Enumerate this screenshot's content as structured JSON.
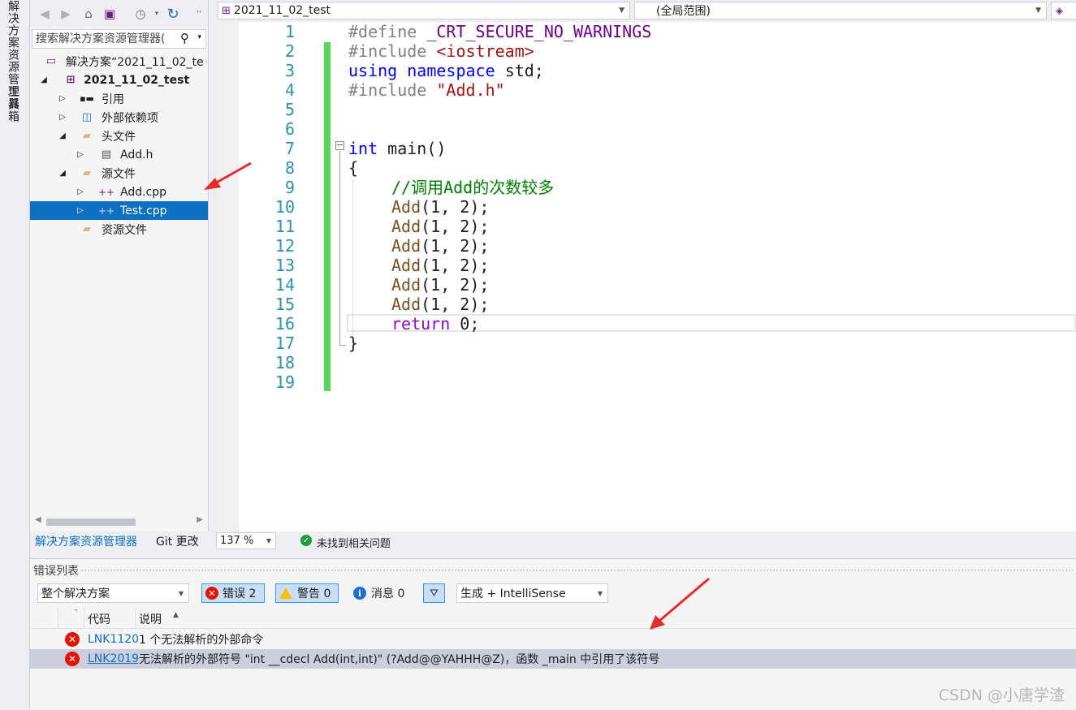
{
  "side_tabs": [
    "解决方案资源管理器",
    "工具箱"
  ],
  "solution_explorer": {
    "search_placeholder": "搜索解决方案资源管理器(",
    "tree": [
      {
        "label": "解决方案“2021_11_02_te",
        "icon": "solution-icon",
        "expander": ""
      },
      {
        "label": "2021_11_02_test",
        "icon": "project-icon",
        "expander": "expanded",
        "bold": true
      },
      {
        "label": "引用",
        "icon": "references-icon",
        "expander": "collapsed"
      },
      {
        "label": "外部依赖项",
        "icon": "external-deps-icon",
        "expander": "collapsed"
      },
      {
        "label": "头文件",
        "icon": "folder-icon",
        "expander": "expanded"
      },
      {
        "label": "Add.h",
        "icon": "header-file-icon",
        "expander": "collapsed"
      },
      {
        "label": "源文件",
        "icon": "folder-icon",
        "expander": "expanded"
      },
      {
        "label": "Add.cpp",
        "icon": "cpp-file-icon",
        "expander": "collapsed"
      },
      {
        "label": "Test.cpp",
        "icon": "cpp-file-icon",
        "expander": "collapsed",
        "selected": true
      },
      {
        "label": "资源文件",
        "icon": "folder-icon",
        "expander": ""
      }
    ],
    "bottom_tabs": [
      "解决方案资源管理器",
      "Git 更改"
    ]
  },
  "editor": {
    "project_dropdown": "2021_11_02_test",
    "scope_dropdown": "(全局范围)",
    "zoom": "137 %",
    "status": "未找到相关问题",
    "line_numbers": [
      "1",
      "2",
      "3",
      "4",
      "5",
      "6",
      "7",
      "8",
      "9",
      "10",
      "11",
      "12",
      "13",
      "14",
      "15",
      "16",
      "17",
      "18",
      "19"
    ],
    "lines": {
      "l1_directive": "#define",
      "l1_macro": "_CRT_SECURE_NO_WARNINGS",
      "l2_directive": "#include",
      "l2_header": "<iostream>",
      "l3_using": "using",
      "l3_namespace": "namespace",
      "l3_std": "std;",
      "l4_directive": "#include",
      "l4_header": "\"Add.h\"",
      "l7_int": "int",
      "l7_main": "main()",
      "l8": "{",
      "l9_comment": "//调用Add的次数较多",
      "call_fn": "Add",
      "call_args": "(1, 2);",
      "l16_return": "return",
      "l16_value": "0;",
      "l17": "}"
    }
  },
  "error_list": {
    "title": "错误列表",
    "scope_select": "整个解决方案",
    "errors_btn": "错误 2",
    "warnings_btn": "警告 0",
    "messages_btn": "消息 0",
    "source_select": "生成 + IntelliSense",
    "col_code": "代码",
    "col_desc": "说明",
    "rows": [
      {
        "code": "LNK1120",
        "desc": "1 个无法解析的外部命令"
      },
      {
        "code": "LNK2019",
        "desc": "无法解析的外部符号 \"int __cdecl Add(int,int)\" (?Add@@YAHHH@Z)，函数 _main 中引用了该符号"
      }
    ]
  },
  "watermark": "CSDN @小唐学渣",
  "colors": {
    "accent": "#0e70c0",
    "keyword": "#0000ff",
    "comment": "#008000",
    "macro": "#6f008a",
    "string": "#a31515",
    "function": "#74531f",
    "linenum": "#2b91af",
    "changebar": "#57d65a",
    "error": "#e51400"
  }
}
